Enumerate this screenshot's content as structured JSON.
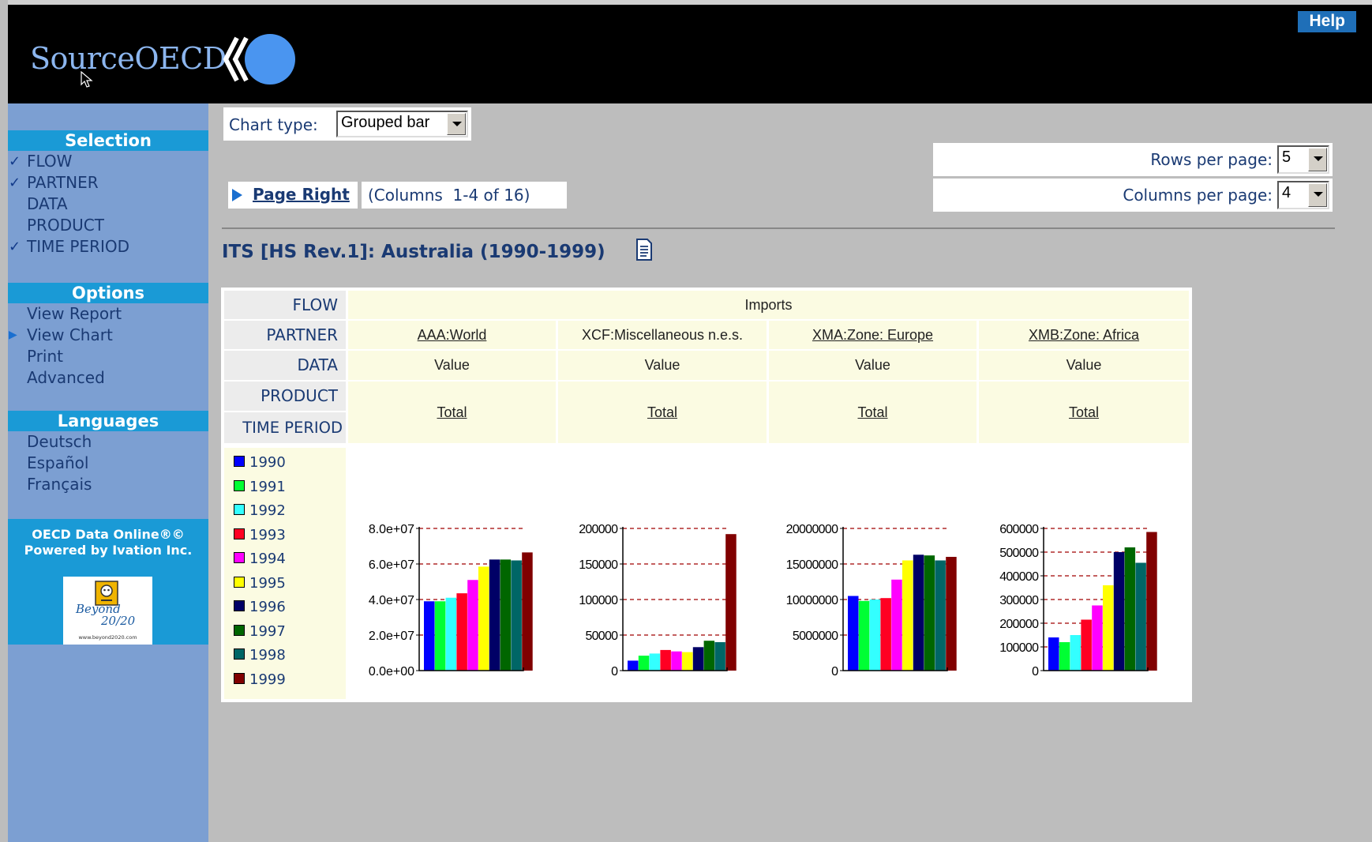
{
  "header": {
    "logo_text": "SourceOECD",
    "help_label": "Help"
  },
  "sidebar": {
    "selection_heading": "Selection",
    "selection_items": [
      {
        "label": "FLOW",
        "checked": true
      },
      {
        "label": "PARTNER",
        "checked": true
      },
      {
        "label": "DATA",
        "checked": false
      },
      {
        "label": "PRODUCT",
        "checked": false
      },
      {
        "label": "TIME PERIOD",
        "checked": true
      }
    ],
    "options_heading": "Options",
    "options_items": [
      {
        "label": "View Report",
        "active": false
      },
      {
        "label": "View Chart",
        "active": true
      },
      {
        "label": "Print",
        "active": false
      },
      {
        "label": "Advanced",
        "active": false
      }
    ],
    "languages_heading": "Languages",
    "languages_items": [
      "Deutsch",
      "Español",
      "Français"
    ],
    "powered_line1": "OECD Data Online®©",
    "powered_line2": "Powered by Ivation Inc.",
    "beyond_logo_text1": "Beyond",
    "beyond_logo_text2": "20/20",
    "beyond_logo_url": "www.beyond2020.com"
  },
  "controls": {
    "chart_type_label": "Chart type:",
    "chart_type_value": "Grouped bar",
    "rows_per_page_label": "Rows per page:",
    "rows_per_page_value": "5",
    "columns_per_page_label": "Columns per page:",
    "columns_per_page_value": "4",
    "page_right_label": "Page Right",
    "columns_info": "(Columns  1-4 of 16)"
  },
  "report_title": "ITS [HS Rev.1]: Australia (1990-1999)",
  "table": {
    "dimension_labels": [
      "FLOW",
      "PARTNER",
      "DATA",
      "PRODUCT",
      "TIME PERIOD"
    ],
    "flow_value": "Imports",
    "columns": [
      {
        "partner": "AAA:World",
        "partner_link": true,
        "data": "Value",
        "product": "Total"
      },
      {
        "partner": "XCF:Miscellaneous n.e.s.",
        "partner_link": false,
        "data": "Value",
        "product": "Total"
      },
      {
        "partner": "XMA:Zone: Europe",
        "partner_link": true,
        "data": "Value",
        "product": "Total"
      },
      {
        "partner": "XMB:Zone: Africa",
        "partner_link": true,
        "data": "Value",
        "product": "Total"
      }
    ]
  },
  "legend": [
    {
      "year": "1990",
      "color": "#0000ff"
    },
    {
      "year": "1991",
      "color": "#00ff33"
    },
    {
      "year": "1992",
      "color": "#33ffff"
    },
    {
      "year": "1993",
      "color": "#ff0022"
    },
    {
      "year": "1994",
      "color": "#ff00ff"
    },
    {
      "year": "1995",
      "color": "#ffff00"
    },
    {
      "year": "1996",
      "color": "#000066"
    },
    {
      "year": "1997",
      "color": "#006600"
    },
    {
      "year": "1998",
      "color": "#006666"
    },
    {
      "year": "1999",
      "color": "#800000"
    }
  ],
  "chart_data": [
    {
      "type": "bar",
      "title": "AAA:World",
      "categories": [
        "1990",
        "1991",
        "1992",
        "1993",
        "1994",
        "1995",
        "1996",
        "1997",
        "1998",
        "1999"
      ],
      "values": [
        39000000,
        39000000,
        41000000,
        43500000,
        51000000,
        58500000,
        62500000,
        62500000,
        62000000,
        66500000
      ],
      "ylim": [
        0,
        80000000
      ],
      "yticks": [
        "0.0e+00",
        "2.0e+07",
        "4.0e+07",
        "6.0e+07",
        "8.0e+07"
      ],
      "grid": true
    },
    {
      "type": "bar",
      "title": "XCF:Miscellaneous n.e.s.",
      "categories": [
        "1990",
        "1991",
        "1992",
        "1993",
        "1994",
        "1995",
        "1996",
        "1997",
        "1998",
        "1999"
      ],
      "values": [
        14000,
        21000,
        24000,
        29000,
        27000,
        26000,
        33000,
        42000,
        40000,
        192000
      ],
      "ylim": [
        0,
        200000
      ],
      "yticks": [
        "0",
        "50000",
        "100000",
        "150000",
        "200000"
      ],
      "grid": true
    },
    {
      "type": "bar",
      "title": "XMA:Zone: Europe",
      "categories": [
        "1990",
        "1991",
        "1992",
        "1993",
        "1994",
        "1995",
        "1996",
        "1997",
        "1998",
        "1999"
      ],
      "values": [
        10500000,
        9800000,
        10000000,
        10200000,
        12800000,
        15500000,
        16300000,
        16200000,
        15500000,
        16000000
      ],
      "ylim": [
        0,
        20000000
      ],
      "yticks": [
        "0",
        "5000000",
        "10000000",
        "15000000",
        "20000000"
      ],
      "grid": true
    },
    {
      "type": "bar",
      "title": "XMB:Zone: Africa",
      "categories": [
        "1990",
        "1991",
        "1992",
        "1993",
        "1994",
        "1995",
        "1996",
        "1997",
        "1998",
        "1999"
      ],
      "values": [
        140000,
        120000,
        150000,
        215000,
        275000,
        360000,
        500000,
        520000,
        455000,
        585000
      ],
      "ylim": [
        0,
        600000
      ],
      "yticks": [
        "0",
        "100000",
        "200000",
        "300000",
        "400000",
        "500000",
        "600000"
      ],
      "grid": true
    }
  ]
}
